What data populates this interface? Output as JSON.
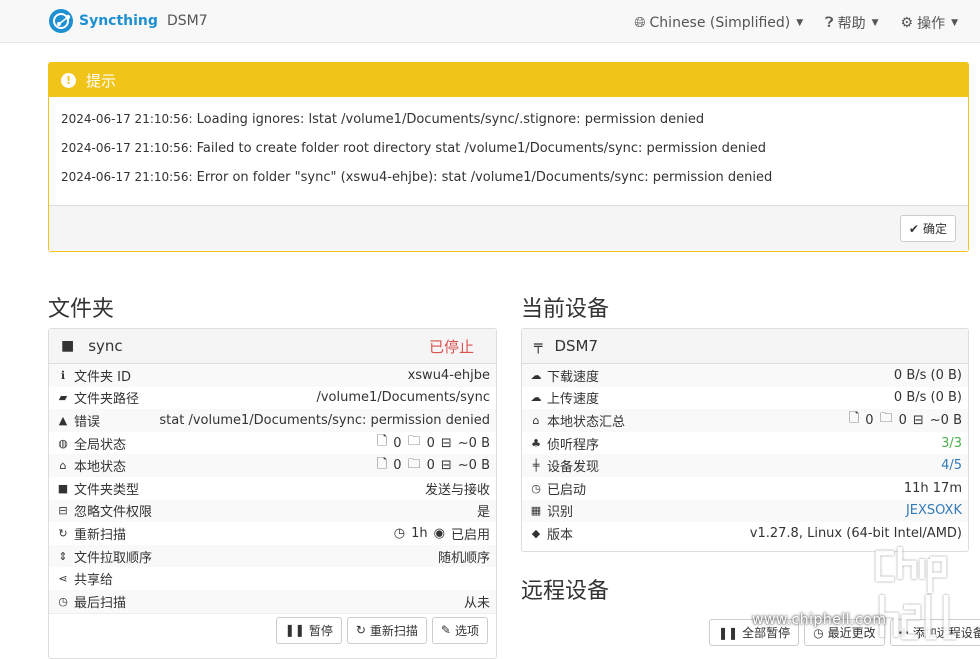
{
  "navbar": {
    "brand": "Syncthing",
    "device": "DSM7",
    "language": "Chinese (Simplified)",
    "help": "帮助",
    "actions": "操作"
  },
  "notice": {
    "title": "提示",
    "lines": [
      {
        "ts": "2024-06-17 21:10:56:",
        "msg": "Loading ignores: lstat /volume1/Documents/sync/.stignore: permission denied"
      },
      {
        "ts": "2024-06-17 21:10:56:",
        "msg": "Failed to create folder root directory stat /volume1/Documents/sync: permission denied"
      },
      {
        "ts": "2024-06-17 21:10:56:",
        "msg": "Error on folder \"sync\" (xswu4-ehjbe): stat /volume1/Documents/sync: permission denied"
      }
    ],
    "ok": "确定"
  },
  "folders": {
    "heading": "文件夹",
    "name": "sync",
    "status": "已停止",
    "rows": {
      "id": {
        "label": "文件夹 ID",
        "value": "xswu4-ehjbe"
      },
      "path": {
        "label": "文件夹路径",
        "value": "/volume1/Documents/sync"
      },
      "error": {
        "label": "错误",
        "value": "stat /volume1/Documents/sync: permission denied"
      },
      "global": {
        "label": "全局状态",
        "files": "0",
        "dirs": "0",
        "size": "~0 B"
      },
      "local": {
        "label": "本地状态",
        "files": "0",
        "dirs": "0",
        "size": "~0 B"
      },
      "type": {
        "label": "文件夹类型",
        "value": "发送与接收"
      },
      "perms": {
        "label": "忽略文件权限",
        "value": "是"
      },
      "rescan": {
        "label": "重新扫描",
        "interval": "1h",
        "watch": "已启用"
      },
      "order": {
        "label": "文件拉取顺序",
        "value": "随机顺序"
      },
      "shared": {
        "label": "共享给",
        "value": ""
      },
      "lastscan": {
        "label": "最后扫描",
        "value": "从未"
      }
    },
    "buttons": {
      "pause": "暂停",
      "rescan": "重新扫描",
      "options": "选项"
    }
  },
  "device": {
    "heading": "当前设备",
    "name": "DSM7",
    "rows": {
      "down": {
        "label": "下载速度",
        "value": "0 B/s (0 B)"
      },
      "up": {
        "label": "上传速度",
        "value": "0 B/s (0 B)"
      },
      "local": {
        "label": "本地状态汇总",
        "files": "0",
        "dirs": "0",
        "size": "~0 B"
      },
      "listeners": {
        "label": "侦听程序",
        "value": "3/3"
      },
      "discovery": {
        "label": "设备发现",
        "value": "4/5"
      },
      "uptime": {
        "label": "已启动",
        "value": "11h 17m"
      },
      "id": {
        "label": "识别",
        "value": "JEXSOXK"
      },
      "version": {
        "label": "版本",
        "value": "v1.27.8, Linux (64-bit Intel/AMD)"
      }
    }
  },
  "remote": {
    "heading": "远程设备",
    "buttons": {
      "pause_all": "全部暂停",
      "recent": "最近更改",
      "add": "添加远程设备"
    }
  },
  "watermark": "www.chiphell.com",
  "colors": {
    "accent": "#1e8fd0",
    "warning": "#f0c419",
    "stopped": "#d9534f",
    "ok": "#4cae4c",
    "link": "#337ab7"
  }
}
